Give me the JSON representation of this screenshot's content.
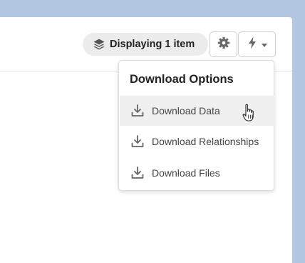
{
  "toolbar": {
    "display_count_label": "Displaying 1 item",
    "icons": {
      "layers": "layers-icon",
      "settings": "gear-icon",
      "actions": "lightning-icon",
      "caret": "caret-down-icon"
    }
  },
  "download_menu": {
    "title": "Download Options",
    "items": [
      {
        "label": "Download Data",
        "icon": "download-icon",
        "hovered": true
      },
      {
        "label": "Download Relationships",
        "icon": "download-icon",
        "hovered": false
      },
      {
        "label": "Download Files",
        "icon": "download-icon",
        "hovered": false
      }
    ]
  },
  "colors": {
    "background": "#b3c6e2",
    "panel": "#ffffff",
    "pill": "#ececec",
    "hover": "#f0f0f0",
    "icon": "#666666"
  }
}
